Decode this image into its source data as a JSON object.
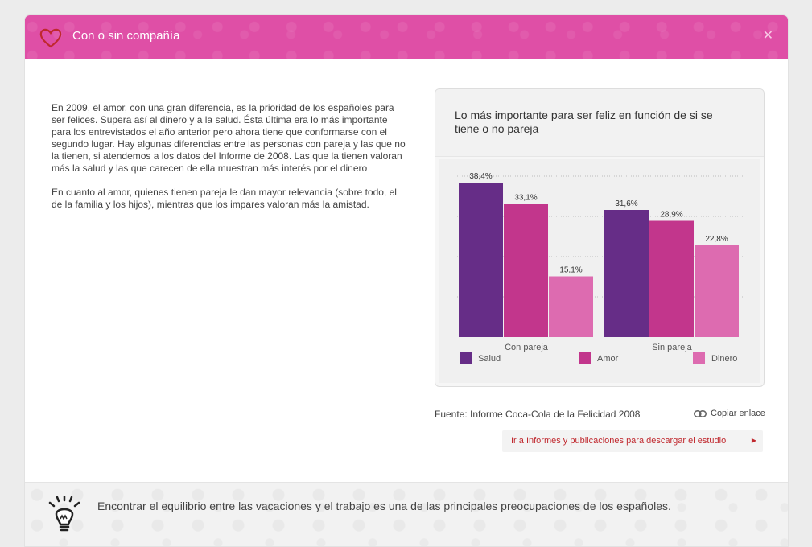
{
  "header": {
    "title": "Con o sin compañía"
  },
  "body": {
    "paragraphs": [
      "En 2009, el amor, con una gran diferencia, es la prioridad de los españoles para ser felices. Supera así al dinero y a la salud. Ésta última era lo más importante para los entrevistados el año anterior pero ahora tiene que conformarse con el segundo lugar. Hay algunas diferencias entre las personas con pareja y las que no la tienen, si atendemos a los datos del Informe de 2008. Las que la tienen valoran más la salud y las que carecen de ella muestran más interés por el dinero",
      "En cuanto al amor, quienes tienen pareja le dan mayor relevancia (sobre todo, el de la familia y los hijos), mientras que los impares valoran más la amistad."
    ]
  },
  "chart_data": {
    "type": "bar",
    "title": "Lo más importante para ser feliz en función de si se tiene o no pareja",
    "categories": [
      "Con pareja",
      "Sin pareja"
    ],
    "series": [
      {
        "name": "Salud",
        "values": [
          38.4,
          31.6
        ],
        "labels": [
          "38,4%",
          "31,6%"
        ],
        "color": "#662d87"
      },
      {
        "name": "Amor",
        "values": [
          33.1,
          28.9
        ],
        "labels": [
          "33,1%",
          "28,9%"
        ],
        "color": "#c2368c"
      },
      {
        "name": "Dinero",
        "values": [
          15.1,
          22.8
        ],
        "labels": [
          "15,1%",
          "22,8%"
        ],
        "color": "#dd6bb0"
      }
    ],
    "ylim": [
      0,
      40
    ],
    "grid": true,
    "legend_position": "bottom"
  },
  "source": "Fuente: Informe Coca-Cola de la Felicidad 2008",
  "copy_link": "Copiar enlace",
  "report_link": "Ir a Informes y publicaciones para descargar el estudio",
  "footer": {
    "text": "Encontrar el equilibrio entre las vacaciones y el trabajo es una de las principales preocupaciones de los españoles."
  },
  "colors": {
    "header": "#df4fa6",
    "link": "#c0282e"
  }
}
